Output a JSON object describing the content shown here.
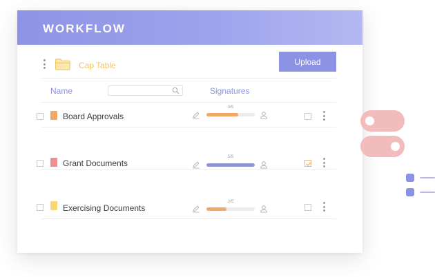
{
  "header": {
    "title": "WORKFLOW"
  },
  "toolbar": {
    "folder_label": "Cap Table",
    "upload_label": "Upload"
  },
  "columns": {
    "name": "Name",
    "signatures": "Signatures",
    "search_placeholder": ""
  },
  "rows": [
    {
      "name": "Board Approvals",
      "file_color": "#f2a766",
      "signed_label": "3/5",
      "progress": 0.65,
      "progress_color": "#f2a766",
      "checked": false
    },
    {
      "name": "Grant Documents",
      "file_color": "#ee8f8f",
      "signed_label": "5/5",
      "progress": 1.0,
      "progress_color": "#8c92e4",
      "checked": true
    },
    {
      "name": "Exercising Documents",
      "file_color": "#f7d873",
      "signed_label": "2/5",
      "progress": 0.42,
      "progress_color": "#f2a766",
      "checked": false
    }
  ],
  "colors": {
    "accent": "#8c92e4",
    "folder": "#f2c45c",
    "toggle": "#f3bcbc"
  },
  "icons": [
    "kebab-menu-icon",
    "folder-icon",
    "search-icon",
    "file-icon",
    "pen-icon",
    "user-icon",
    "checkbox-icon"
  ]
}
